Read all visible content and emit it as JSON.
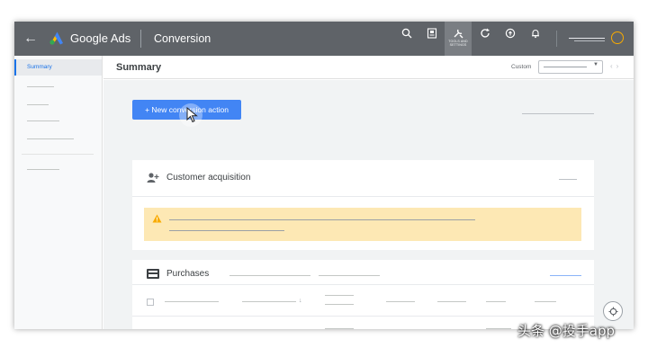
{
  "topbar": {
    "brand": "Google Ads",
    "page_title": "Conversion",
    "tools_caption_line1": "TOOLS AND",
    "tools_caption_line2": "SETTINGS",
    "icons": [
      "search-icon",
      "reports-icon",
      "tools-icon",
      "refresh-icon",
      "help-icon",
      "notifications-icon"
    ]
  },
  "sidebar": {
    "active_item": "Summary"
  },
  "header": {
    "title": "Summary",
    "date_range_label": "Custom"
  },
  "main": {
    "new_button_label": "+ New conversion action",
    "categories": [
      {
        "title": "Customer acquisition"
      },
      {
        "title": "Purchases"
      }
    ]
  },
  "watermark": "头条 @投手app",
  "colors": {
    "topbar": "#5f6368",
    "primary_button": "#4285f4",
    "warning": "#fde8b4",
    "active_nav": "#1a73e8",
    "avatar_ring": "#f9ab00"
  }
}
